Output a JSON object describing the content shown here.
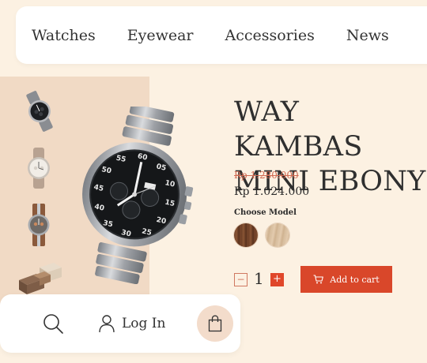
{
  "nav": {
    "items": [
      {
        "label": "Watches"
      },
      {
        "label": "Eyewear"
      },
      {
        "label": "Accessories"
      },
      {
        "label": "News"
      }
    ]
  },
  "product": {
    "title_line1": "WAY KAMBAS",
    "title_line2": "MINI EBONY",
    "old_price": "Rp 1.280.000",
    "new_price": "Rp 1.024.000",
    "choose_model_label": "Choose Model",
    "models": [
      {
        "name": "walnut-swatch",
        "color": "#6b3f26"
      },
      {
        "name": "maple-swatch",
        "color": "#d9bfa0"
      }
    ],
    "quantity": "1",
    "minus_symbol": "−",
    "plus_symbol": "+",
    "add_to_cart_label": "Add to cart"
  },
  "bottom_bar": {
    "login_label": "Log In"
  },
  "colors": {
    "accent": "#d9472a",
    "background": "#fcf1e2",
    "gallery_bg": "#f1dac5",
    "old_price": "#d16a52"
  },
  "icons": [
    "search-icon",
    "user-icon",
    "shopping-bag-icon",
    "cart-icon"
  ]
}
